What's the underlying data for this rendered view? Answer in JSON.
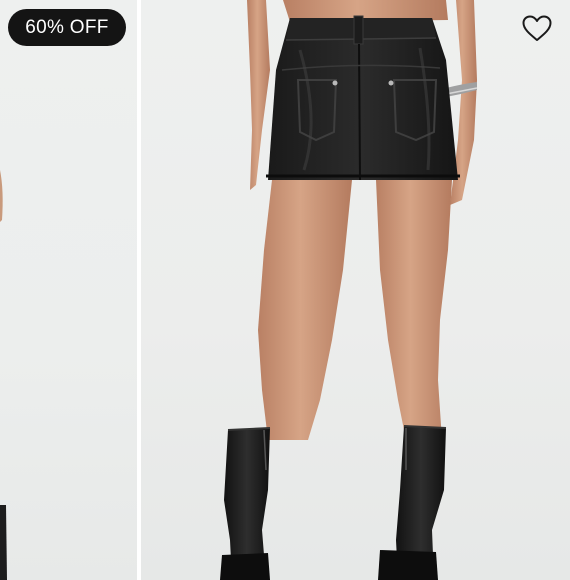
{
  "product_card": {
    "discount_badge": "60% OFF",
    "wishlist_icon": "heart-outline-icon",
    "images": [
      {
        "name": "adjacent-product-photo-partial"
      },
      {
        "name": "leather-mini-skirt-back-view"
      }
    ]
  },
  "colors": {
    "badge_background": "#141414",
    "badge_text": "#ffffff",
    "photo_background": "#eceeed",
    "heart_stroke": "#1a1a1a"
  }
}
